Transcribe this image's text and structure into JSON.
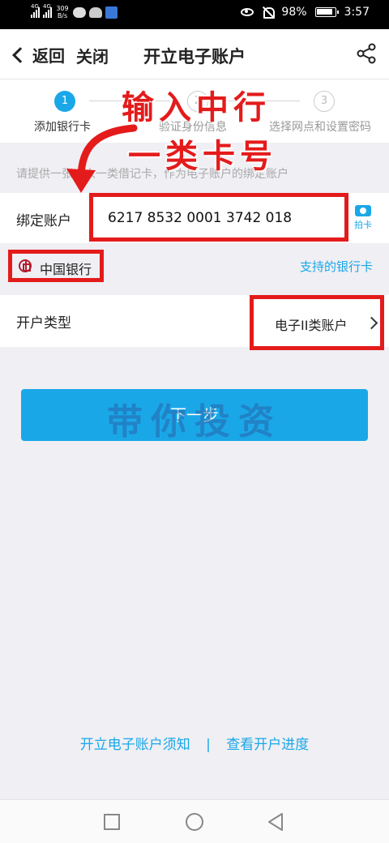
{
  "status_bar": {
    "net_type_1": "4G",
    "net_type_2": "4G",
    "speed_value": "309",
    "speed_unit": "B/s",
    "battery": "98%",
    "time": "3:57",
    "icons": [
      "signal-icon",
      "signal-icon",
      "chat-icon",
      "cloud-icon",
      "app-icon",
      "eye-icon",
      "mute-icon",
      "battery-icon"
    ]
  },
  "header": {
    "back_label": "返回",
    "close_label": "关闭",
    "title": "开立电子账户"
  },
  "steps": [
    {
      "num": "1",
      "label": "添加银行卡",
      "active": true
    },
    {
      "num": "2",
      "label": "验证身份信息",
      "active": false
    },
    {
      "num": "3",
      "label": "选择网点和设置密码",
      "active": false
    }
  ],
  "hint": "请提供一张本人一类借记卡，作为电子账户的绑定账户",
  "account": {
    "label": "绑定账户",
    "value": "6217 8532 0001 3742 018",
    "camera_label": "拍卡"
  },
  "bank": {
    "name": "中国银行",
    "supported_link": "支持的银行卡"
  },
  "account_type": {
    "label": "开户类型",
    "value": "电子II类账户"
  },
  "next_button": "下一步",
  "overlay": {
    "line1": "输入中行",
    "line2": "一类卡号",
    "watermark": "带你投资"
  },
  "footer": {
    "link1": "开立电子账户须知",
    "separator": "|",
    "link2": "查看开户进度"
  },
  "colors": {
    "accent": "#1aa7e8",
    "highlight": "#e41b1b"
  }
}
